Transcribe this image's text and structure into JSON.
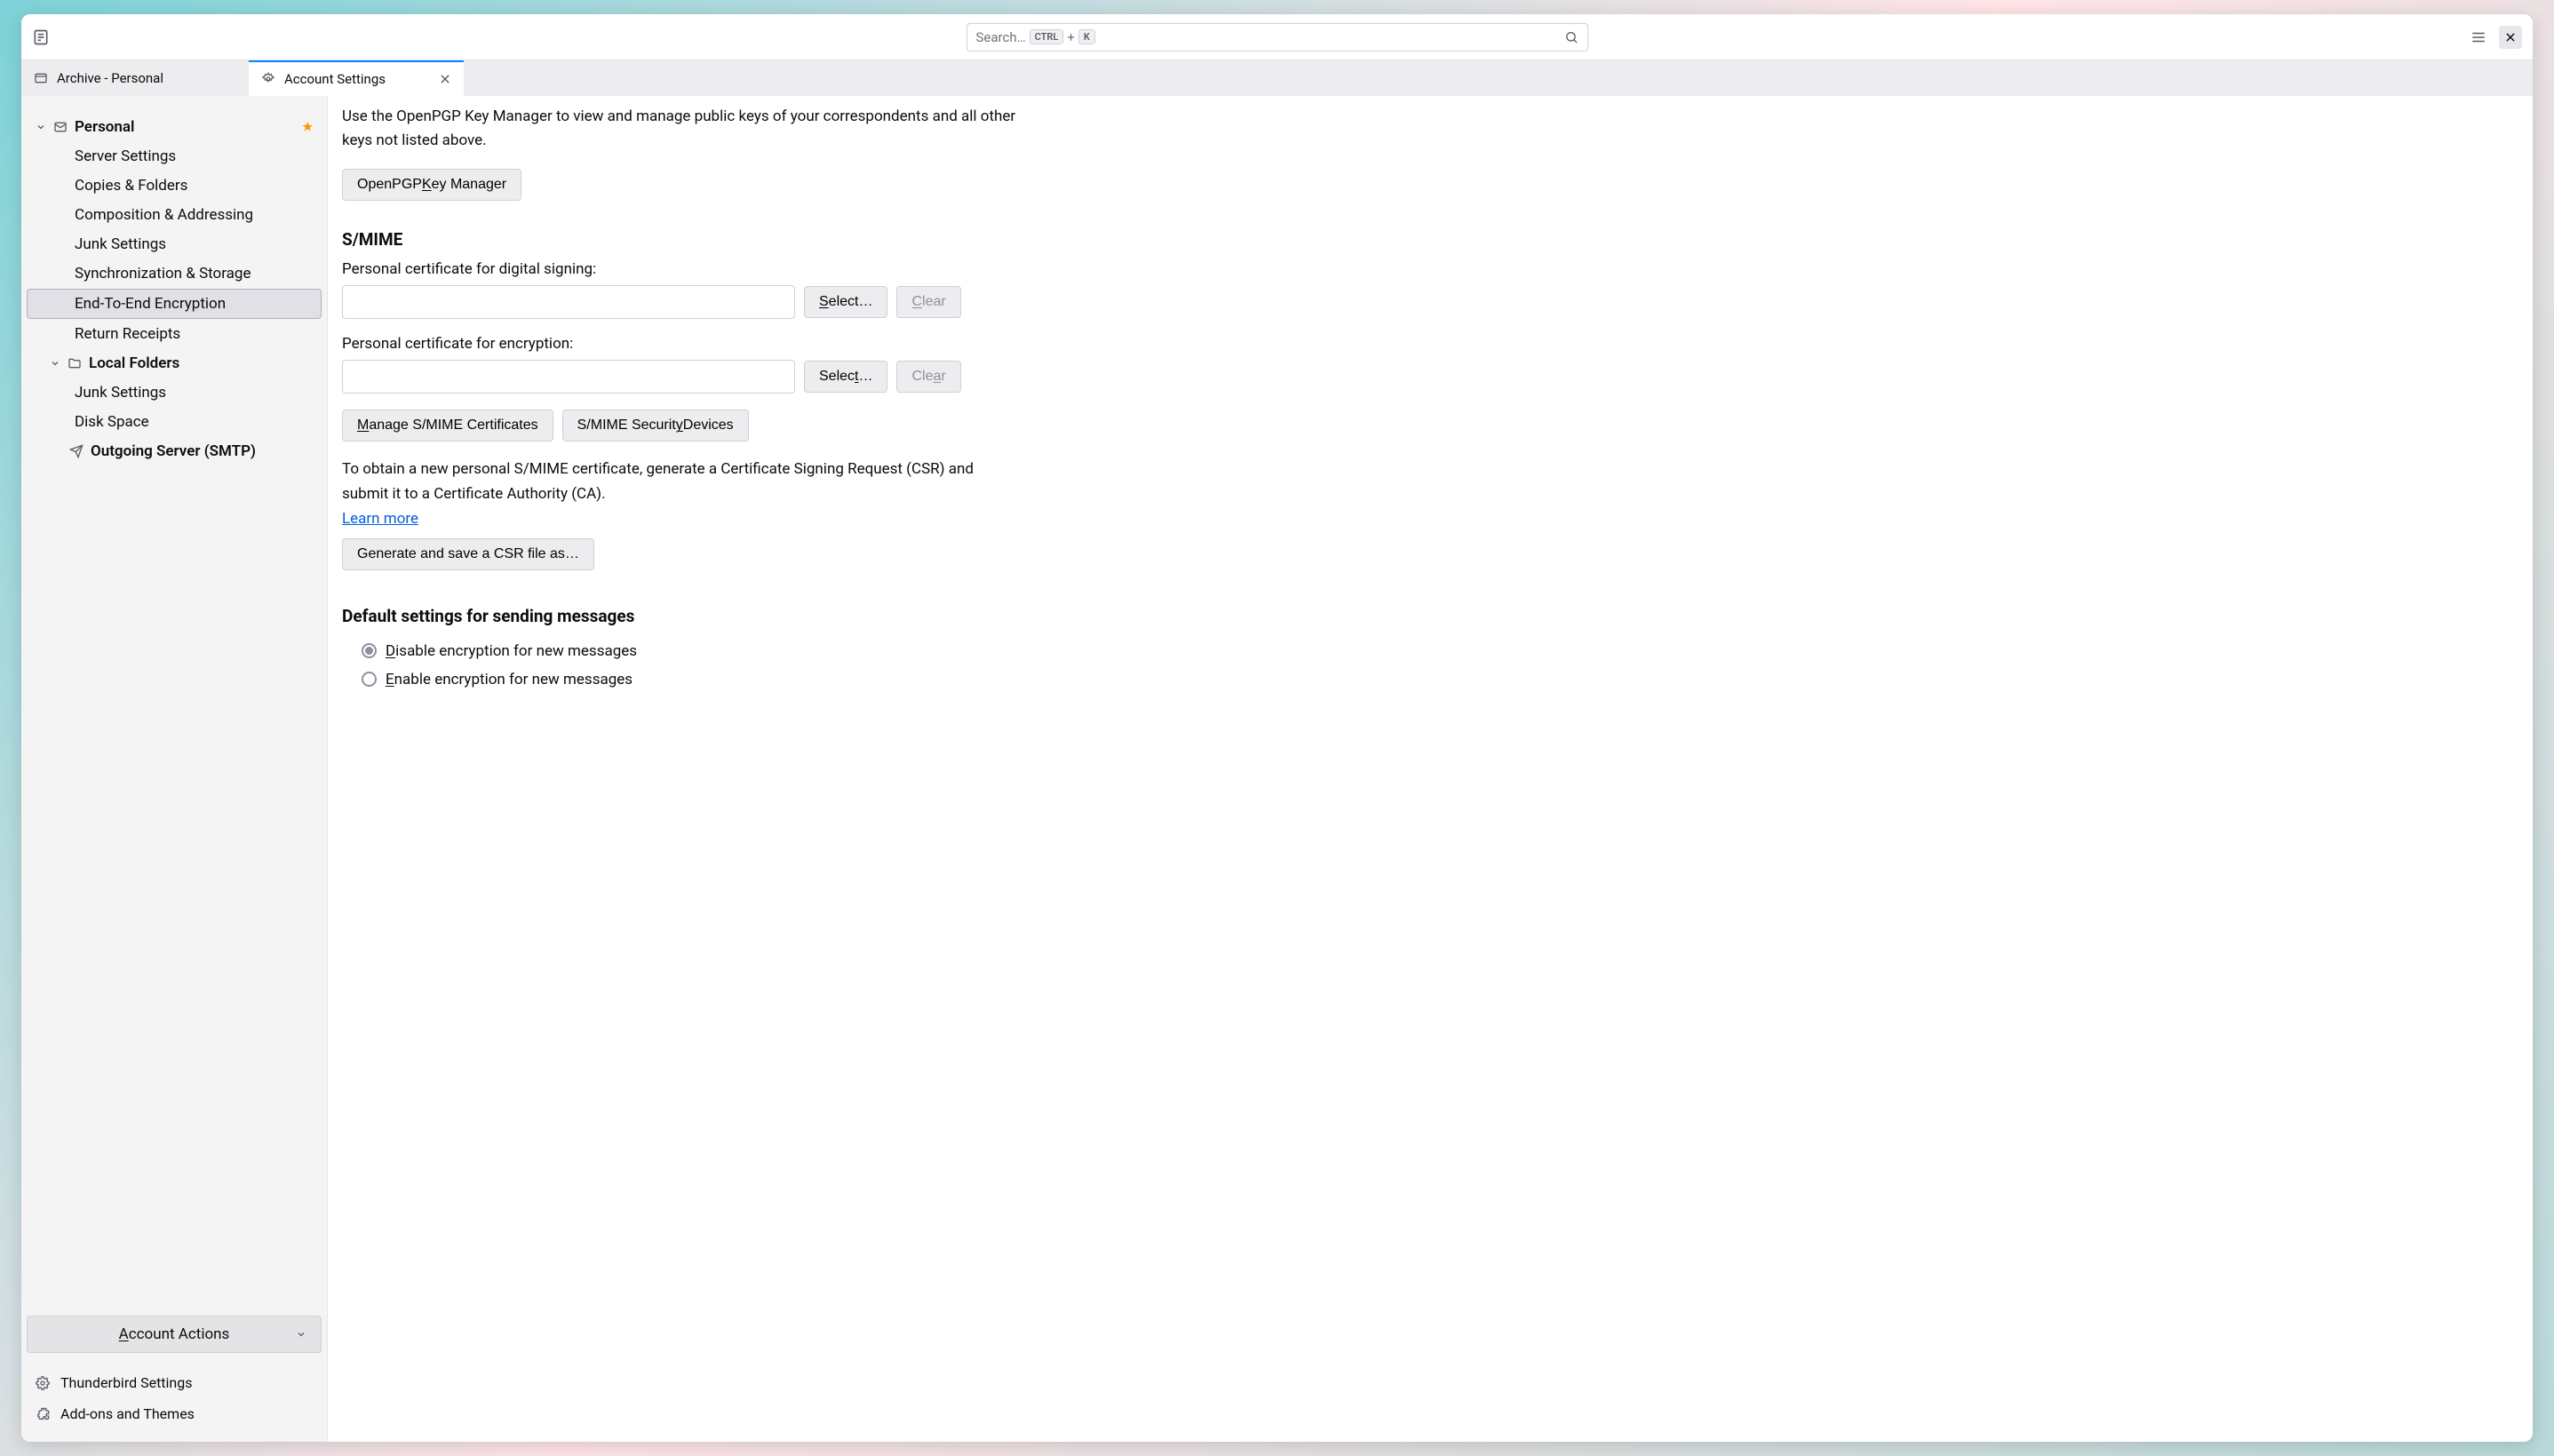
{
  "search": {
    "placeholder_text": "Search…",
    "kbd1": "CTRL",
    "plus": "+",
    "kbd2": "K"
  },
  "tabs": [
    {
      "label": "Archive - Personal"
    },
    {
      "label": "Account Settings"
    }
  ],
  "sidebar": {
    "accounts": [
      {
        "name": "Personal",
        "starred": true,
        "children": [
          "Server Settings",
          "Copies & Folders",
          "Composition & Addressing",
          "Junk Settings",
          "Synchronization & Storage",
          "End-To-End Encryption",
          "Return Receipts"
        ],
        "selected_index": 5
      },
      {
        "name": "Local Folders",
        "children": [
          "Junk Settings",
          "Disk Space"
        ]
      },
      {
        "name": "Outgoing Server (SMTP)"
      }
    ],
    "account_actions_label_pre": "A",
    "account_actions_label_post": "ccount Actions",
    "thunderbird_settings": "Thunderbird Settings",
    "addons_themes": "Add-ons and Themes"
  },
  "content": {
    "openpgp_info": "Use the OpenPGP Key Manager to view and manage public keys of your correspondents and all other keys not listed above.",
    "openpgp_btn_pre": "OpenPGP ",
    "openpgp_btn_u": "K",
    "openpgp_btn_post": "ey Manager",
    "smime_heading": "S/MIME",
    "signing_label": "Personal certificate for digital signing:",
    "encryption_label": "Personal certificate for encryption:",
    "select_btn_u": "S",
    "select_btn_post": "elect…",
    "select2_btn_pre": "Selec",
    "select2_btn_u": "t",
    "select2_btn_post": "…",
    "clear_btn_u": "C",
    "clear_btn_post": "lear",
    "clear2_btn_pre": "Cle",
    "clear2_btn_u": "a",
    "clear2_btn_post": "r",
    "manage_smime_u": "M",
    "manage_smime_post": "anage S/MIME Certificates",
    "smime_devices_pre": "S/MIME Securit",
    "smime_devices_u": "y",
    "smime_devices_post": " Devices",
    "csr_text": "To obtain a new personal S/MIME certificate, generate a Certificate Signing Request (CSR) and submit it to a Certificate Authority (CA).",
    "learn_more": "Learn more",
    "generate_csr": "Generate and save a CSR file as…",
    "default_heading": "Default settings for sending messages",
    "radio_disable_u": "D",
    "radio_disable_post": "isable encryption for new messages",
    "radio_enable_u": "E",
    "radio_enable_post": "nable encryption for new messages"
  }
}
